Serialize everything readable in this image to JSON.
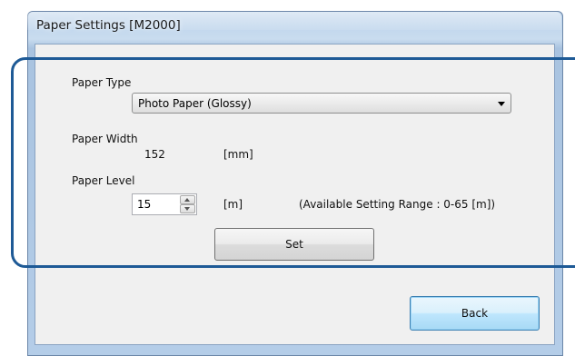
{
  "window": {
    "title": "Paper Settings [M2000]"
  },
  "paper_type": {
    "label": "Paper Type",
    "selected": "Photo Paper (Glossy)"
  },
  "paper_width": {
    "label": "Paper Width",
    "value": "152",
    "unit": "[mm]"
  },
  "paper_level": {
    "label": "Paper Level",
    "value": "15",
    "unit": "[m]",
    "range_note": "(Available Setting Range : 0-65 [m])"
  },
  "buttons": {
    "set": "Set",
    "back": "Back"
  }
}
